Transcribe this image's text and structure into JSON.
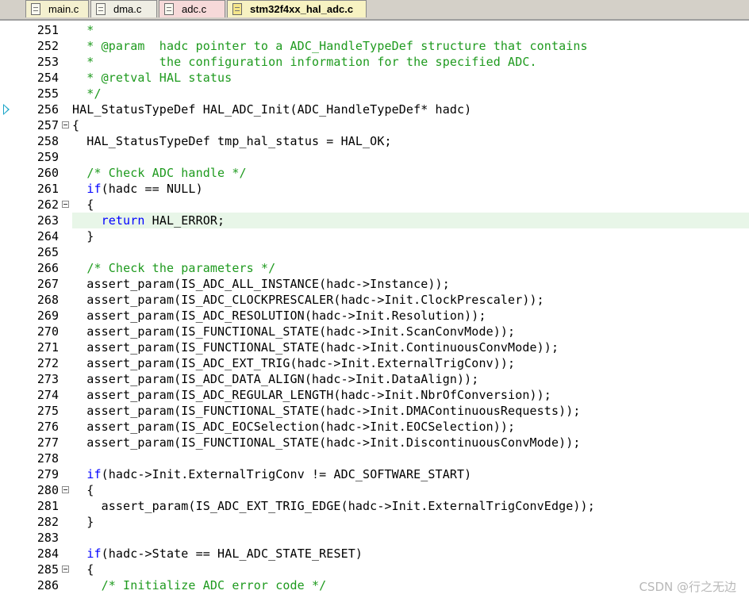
{
  "tabs": [
    {
      "label": "main.c",
      "active": false
    },
    {
      "label": "dma.c",
      "active": false
    },
    {
      "label": "adc.c",
      "active": false
    },
    {
      "label": "stm32f4xx_hal_adc.c",
      "active": true
    }
  ],
  "lines": [
    {
      "n": "251",
      "fold": false,
      "hl": false,
      "arrow": false,
      "segs": [
        {
          "t": "  *",
          "c": "cm"
        }
      ]
    },
    {
      "n": "252",
      "fold": false,
      "hl": false,
      "arrow": false,
      "segs": [
        {
          "t": "  * @param  hadc pointer to a ADC_HandleTypeDef structure that contains",
          "c": "cm"
        }
      ]
    },
    {
      "n": "253",
      "fold": false,
      "hl": false,
      "arrow": false,
      "segs": [
        {
          "t": "  *         the configuration information for the specified ADC.",
          "c": "cm"
        }
      ]
    },
    {
      "n": "254",
      "fold": false,
      "hl": false,
      "arrow": false,
      "segs": [
        {
          "t": "  * @retval HAL status",
          "c": "cm"
        }
      ]
    },
    {
      "n": "255",
      "fold": false,
      "hl": false,
      "arrow": false,
      "segs": [
        {
          "t": "  */",
          "c": "cm"
        }
      ]
    },
    {
      "n": "256",
      "fold": false,
      "hl": false,
      "arrow": true,
      "segs": [
        {
          "t": "HAL_StatusTypeDef HAL_ADC_Init(ADC_HandleTypeDef* hadc)",
          "c": ""
        }
      ]
    },
    {
      "n": "257",
      "fold": true,
      "hl": false,
      "arrow": false,
      "segs": [
        {
          "t": "{",
          "c": ""
        }
      ]
    },
    {
      "n": "258",
      "fold": false,
      "hl": false,
      "arrow": false,
      "segs": [
        {
          "t": "  HAL_StatusTypeDef tmp_hal_status = HAL_OK;",
          "c": ""
        }
      ]
    },
    {
      "n": "259",
      "fold": false,
      "hl": false,
      "arrow": false,
      "segs": []
    },
    {
      "n": "260",
      "fold": false,
      "hl": false,
      "arrow": false,
      "segs": [
        {
          "t": "  ",
          "c": ""
        },
        {
          "t": "/* Check ADC handle */",
          "c": "cm"
        }
      ]
    },
    {
      "n": "261",
      "fold": false,
      "hl": false,
      "arrow": false,
      "segs": [
        {
          "t": "  ",
          "c": ""
        },
        {
          "t": "if",
          "c": "kw"
        },
        {
          "t": "(hadc == NULL)",
          "c": ""
        }
      ]
    },
    {
      "n": "262",
      "fold": true,
      "hl": false,
      "arrow": false,
      "segs": [
        {
          "t": "  {",
          "c": ""
        }
      ]
    },
    {
      "n": "263",
      "fold": false,
      "hl": true,
      "arrow": false,
      "segs": [
        {
          "t": "    ",
          "c": ""
        },
        {
          "t": "return",
          "c": "kw"
        },
        {
          "t": " HAL_ERROR;",
          "c": ""
        }
      ]
    },
    {
      "n": "264",
      "fold": false,
      "hl": false,
      "arrow": false,
      "segs": [
        {
          "t": "  }",
          "c": ""
        }
      ]
    },
    {
      "n": "265",
      "fold": false,
      "hl": false,
      "arrow": false,
      "segs": []
    },
    {
      "n": "266",
      "fold": false,
      "hl": false,
      "arrow": false,
      "segs": [
        {
          "t": "  ",
          "c": ""
        },
        {
          "t": "/* Check the parameters */",
          "c": "cm"
        }
      ]
    },
    {
      "n": "267",
      "fold": false,
      "hl": false,
      "arrow": false,
      "segs": [
        {
          "t": "  assert_param(IS_ADC_ALL_INSTANCE(hadc->Instance));",
          "c": ""
        }
      ]
    },
    {
      "n": "268",
      "fold": false,
      "hl": false,
      "arrow": false,
      "segs": [
        {
          "t": "  assert_param(IS_ADC_CLOCKPRESCALER(hadc->Init.ClockPrescaler));",
          "c": ""
        }
      ]
    },
    {
      "n": "269",
      "fold": false,
      "hl": false,
      "arrow": false,
      "segs": [
        {
          "t": "  assert_param(IS_ADC_RESOLUTION(hadc->Init.Resolution));",
          "c": ""
        }
      ]
    },
    {
      "n": "270",
      "fold": false,
      "hl": false,
      "arrow": false,
      "segs": [
        {
          "t": "  assert_param(IS_FUNCTIONAL_STATE(hadc->Init.ScanConvMode));",
          "c": ""
        }
      ]
    },
    {
      "n": "271",
      "fold": false,
      "hl": false,
      "arrow": false,
      "segs": [
        {
          "t": "  assert_param(IS_FUNCTIONAL_STATE(hadc->Init.ContinuousConvMode));",
          "c": ""
        }
      ]
    },
    {
      "n": "272",
      "fold": false,
      "hl": false,
      "arrow": false,
      "segs": [
        {
          "t": "  assert_param(IS_ADC_EXT_TRIG(hadc->Init.ExternalTrigConv));",
          "c": ""
        }
      ]
    },
    {
      "n": "273",
      "fold": false,
      "hl": false,
      "arrow": false,
      "segs": [
        {
          "t": "  assert_param(IS_ADC_DATA_ALIGN(hadc->Init.DataAlign));",
          "c": ""
        }
      ]
    },
    {
      "n": "274",
      "fold": false,
      "hl": false,
      "arrow": false,
      "segs": [
        {
          "t": "  assert_param(IS_ADC_REGULAR_LENGTH(hadc->Init.NbrOfConversion));",
          "c": ""
        }
      ]
    },
    {
      "n": "275",
      "fold": false,
      "hl": false,
      "arrow": false,
      "segs": [
        {
          "t": "  assert_param(IS_FUNCTIONAL_STATE(hadc->Init.DMAContinuousRequests));",
          "c": ""
        }
      ]
    },
    {
      "n": "276",
      "fold": false,
      "hl": false,
      "arrow": false,
      "segs": [
        {
          "t": "  assert_param(IS_ADC_EOCSelection(hadc->Init.EOCSelection));",
          "c": ""
        }
      ]
    },
    {
      "n": "277",
      "fold": false,
      "hl": false,
      "arrow": false,
      "segs": [
        {
          "t": "  assert_param(IS_FUNCTIONAL_STATE(hadc->Init.DiscontinuousConvMode));",
          "c": ""
        }
      ]
    },
    {
      "n": "278",
      "fold": false,
      "hl": false,
      "arrow": false,
      "segs": []
    },
    {
      "n": "279",
      "fold": false,
      "hl": false,
      "arrow": false,
      "segs": [
        {
          "t": "  ",
          "c": ""
        },
        {
          "t": "if",
          "c": "kw"
        },
        {
          "t": "(hadc->Init.ExternalTrigConv != ADC_SOFTWARE_START)",
          "c": ""
        }
      ]
    },
    {
      "n": "280",
      "fold": true,
      "hl": false,
      "arrow": false,
      "segs": [
        {
          "t": "  {",
          "c": ""
        }
      ]
    },
    {
      "n": "281",
      "fold": false,
      "hl": false,
      "arrow": false,
      "segs": [
        {
          "t": "    assert_param(IS_ADC_EXT_TRIG_EDGE(hadc->Init.ExternalTrigConvEdge));",
          "c": ""
        }
      ]
    },
    {
      "n": "282",
      "fold": false,
      "hl": false,
      "arrow": false,
      "segs": [
        {
          "t": "  }",
          "c": ""
        }
      ]
    },
    {
      "n": "283",
      "fold": false,
      "hl": false,
      "arrow": false,
      "segs": []
    },
    {
      "n": "284",
      "fold": false,
      "hl": false,
      "arrow": false,
      "segs": [
        {
          "t": "  ",
          "c": ""
        },
        {
          "t": "if",
          "c": "kw"
        },
        {
          "t": "(hadc->State == HAL_ADC_STATE_RESET)",
          "c": ""
        }
      ]
    },
    {
      "n": "285",
      "fold": true,
      "hl": false,
      "arrow": false,
      "segs": [
        {
          "t": "  {",
          "c": ""
        }
      ]
    },
    {
      "n": "286",
      "fold": false,
      "hl": false,
      "arrow": false,
      "segs": [
        {
          "t": "    ",
          "c": ""
        },
        {
          "t": "/* Initialize ADC error code */",
          "c": "cm"
        }
      ]
    }
  ],
  "watermark": "CSDN @行之无边"
}
